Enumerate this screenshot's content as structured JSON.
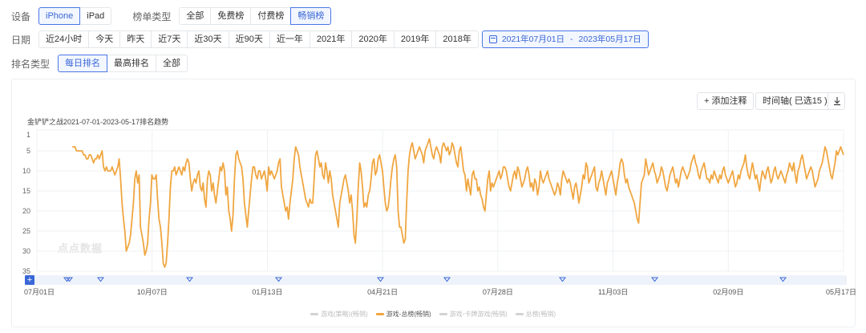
{
  "filters": {
    "device_label": "设备",
    "devices": [
      "iPhone",
      "iPad"
    ],
    "device_selected": 0,
    "list_type_label": "榜单类型",
    "list_types": [
      "全部",
      "免费榜",
      "付费榜",
      "畅销榜"
    ],
    "list_type_selected": 3,
    "date_label": "日期",
    "dates": [
      "近24小时",
      "今天",
      "昨天",
      "近7天",
      "近30天",
      "近90天",
      "近一年",
      "2021年",
      "2020年",
      "2019年",
      "2018年"
    ],
    "date_range": {
      "start": "2021年07月01日",
      "sep": "-",
      "end": "2023年05月17日"
    },
    "rank_type_label": "排名类型",
    "rank_types": [
      "每日排名",
      "最高排名",
      "全部"
    ],
    "rank_type_selected": 0
  },
  "toolbar": {
    "add_note": "+ 添加注释",
    "timeline": "时间轴( 已选15 )",
    "download_icon": "download-icon"
  },
  "chart_title": "金铲铲之战2021-07-01-2023-05-17排名趋势",
  "watermark": "点点数据",
  "colors": {
    "line": "#f0a640",
    "accent": "#3a67d6",
    "grid": "#eef0f3"
  },
  "chart_data": {
    "type": "line",
    "title": "金铲铲之战2021-07-01-2023-05-17排名趋势",
    "x_range": [
      "2021-07-01",
      "2023-05-17"
    ],
    "x_ticks": [
      "07月01日",
      "10月07日",
      "01月13日",
      "04月21日",
      "07月28日",
      "11月03日",
      "02月09日",
      "05月17日"
    ],
    "y_ticks": [
      1,
      5,
      10,
      15,
      20,
      25,
      30,
      35
    ],
    "ylim": [
      1,
      35
    ],
    "y_inverted": true,
    "grid": true,
    "legend_position": "bottom",
    "legend": [
      "游戏(策略)(畅销)",
      "游戏-总榜(畅销)",
      "游戏-卡牌游戏(畅销)",
      "总榜(畅销)"
    ],
    "active_series": 1,
    "series": [
      {
        "name": "游戏-总榜(畅销)",
        "start_date": "2021-07-31",
        "values": [
          4,
          4,
          4,
          5,
          5,
          5,
          5,
          5,
          6,
          6,
          7,
          7,
          6,
          6,
          7,
          8,
          7,
          7,
          6,
          7,
          6,
          5,
          9,
          10,
          9,
          10,
          10,
          10,
          9,
          10,
          11,
          10,
          9,
          7,
          12,
          18,
          22,
          25,
          30,
          29,
          28,
          26,
          22,
          18,
          12,
          10,
          13,
          11,
          24,
          26,
          28,
          31,
          30,
          28,
          22,
          18,
          11,
          12,
          12,
          11,
          17,
          22,
          24,
          28,
          33,
          34,
          33,
          28,
          22,
          14,
          10,
          10,
          9,
          11,
          10,
          9,
          10,
          11,
          9,
          10,
          8,
          7,
          8,
          12,
          15,
          13,
          12,
          13,
          11,
          10,
          14,
          15,
          13,
          17,
          19,
          12,
          10,
          11,
          15,
          13,
          16,
          18,
          15,
          12,
          9,
          10,
          8,
          10,
          16,
          14,
          20,
          22,
          25,
          21,
          12,
          6,
          5,
          7,
          8,
          9,
          12,
          18,
          21,
          24,
          20,
          16,
          12,
          9,
          9,
          11,
          12,
          10,
          10,
          12,
          11,
          10,
          12,
          15,
          9,
          11,
          10,
          11,
          12,
          11,
          10,
          8,
          7,
          14,
          16,
          18,
          20,
          19,
          22,
          18,
          15,
          12,
          7,
          4,
          5,
          6,
          9,
          11,
          13,
          15,
          17,
          18,
          19,
          17,
          18,
          18,
          12,
          6,
          5,
          7,
          9,
          8,
          11,
          12,
          8,
          10,
          13,
          10,
          12,
          16,
          18,
          20,
          22,
          24,
          18,
          16,
          14,
          12,
          11,
          13,
          15,
          18,
          16,
          20,
          26,
          28,
          22,
          14,
          8,
          10,
          14,
          19,
          18,
          19,
          16,
          15,
          12,
          8,
          7,
          11,
          10,
          7,
          6,
          8,
          10,
          14,
          18,
          20,
          19,
          16,
          12,
          9,
          7,
          6,
          9,
          20,
          24,
          24,
          26,
          28,
          27,
          18,
          10,
          6,
          4,
          3,
          5,
          7,
          6,
          5,
          4,
          5,
          6,
          8,
          5,
          4,
          3,
          2,
          4,
          6,
          7,
          5,
          4,
          5,
          6,
          8,
          4,
          3,
          4,
          5,
          4,
          6,
          5,
          3,
          4,
          6,
          8,
          9,
          5,
          4,
          7,
          10,
          11,
          15,
          12,
          14,
          16,
          11,
          10,
          12,
          12,
          15,
          14,
          16,
          17,
          19,
          20,
          16,
          12,
          10,
          15,
          13,
          14,
          13,
          12,
          11,
          10,
          12,
          11,
          9,
          9,
          10,
          12,
          14,
          15,
          13,
          11,
          10,
          12,
          9,
          10,
          12,
          14,
          13,
          12,
          10,
          9,
          11,
          14,
          13,
          15,
          12,
          13,
          16,
          14,
          10,
          12,
          13,
          12,
          11,
          10,
          12,
          13,
          14,
          15,
          16,
          15,
          13,
          14,
          16,
          12,
          10,
          11,
          12,
          13,
          12,
          13,
          15,
          17,
          14,
          13,
          15,
          18,
          16,
          14,
          11,
          12,
          8,
          9,
          13,
          12,
          11,
          10,
          9,
          14,
          15,
          13,
          12,
          10,
          12,
          14,
          16,
          13,
          12,
          11,
          10,
          12,
          14,
          16,
          13,
          11,
          8,
          7,
          8,
          11,
          13,
          12,
          14,
          15,
          16,
          17,
          18,
          20,
          22,
          23,
          18,
          13,
          12,
          11,
          7,
          9,
          11,
          10,
          9,
          8,
          10,
          11,
          13,
          12,
          11,
          9,
          10,
          12,
          14,
          15,
          13,
          11,
          10,
          9,
          11,
          13,
          12,
          14,
          12,
          10,
          9,
          10,
          11,
          12,
          11,
          10,
          8,
          7,
          6,
          8,
          9,
          11,
          12,
          10,
          9,
          8,
          10,
          12,
          12,
          13,
          11,
          12,
          10,
          11,
          12,
          13,
          11,
          12,
          10,
          9,
          11,
          12,
          13,
          12,
          11,
          10,
          12,
          14,
          13,
          11,
          12,
          10,
          9,
          8,
          6,
          9,
          11,
          12,
          10,
          8,
          10,
          12,
          11,
          13,
          15,
          12,
          10,
          11,
          12,
          10,
          9,
          11,
          13,
          12,
          10,
          9,
          11,
          12,
          11,
          10,
          11,
          12,
          13,
          11,
          10,
          8,
          9,
          10,
          8,
          11,
          13,
          10,
          9,
          7,
          6,
          8,
          10,
          12,
          11,
          10,
          9,
          10,
          12,
          14,
          13,
          12,
          10,
          9,
          8,
          6,
          4,
          5,
          7,
          9,
          11,
          12,
          10,
          8,
          5,
          6,
          5,
          4,
          5,
          6
        ]
      }
    ]
  }
}
